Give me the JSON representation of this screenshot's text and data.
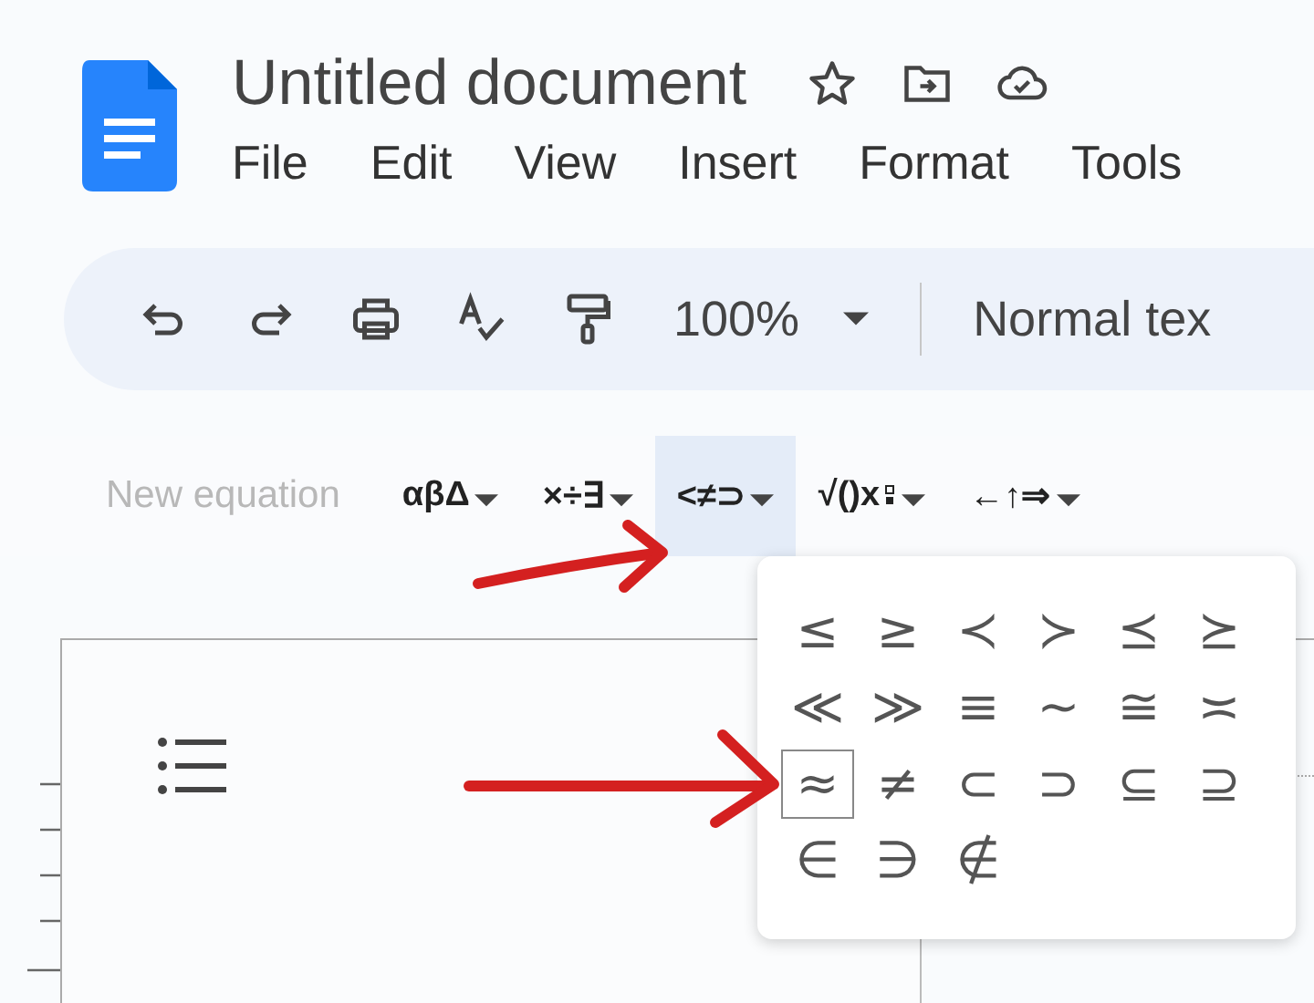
{
  "document": {
    "title": "Untitled document"
  },
  "menu": [
    {
      "label": "File"
    },
    {
      "label": "Edit"
    },
    {
      "label": "View"
    },
    {
      "label": "Insert"
    },
    {
      "label": "Format"
    },
    {
      "label": "Tools"
    }
  ],
  "toolbar": {
    "zoom": "100%",
    "style": "Normal tex"
  },
  "equation_bar": {
    "new_equation": "New equation",
    "groups": [
      {
        "label": "αβΔ",
        "kind": "text",
        "selected": false
      },
      {
        "label": "×÷∃",
        "kind": "text",
        "selected": false
      },
      {
        "label": "<≠⊃",
        "kind": "text",
        "selected": true
      },
      {
        "label": "√()x",
        "kind": "script",
        "selected": false
      },
      {
        "label": "←↑⇒",
        "kind": "text",
        "selected": false
      }
    ]
  },
  "symbol_menu": {
    "rows": [
      [
        {
          "symbol": "≤",
          "selected": false
        },
        {
          "symbol": "≥",
          "selected": false
        },
        {
          "symbol": "≺",
          "selected": false
        },
        {
          "symbol": "≻",
          "selected": false
        },
        {
          "symbol": "⪯",
          "selected": false
        },
        {
          "symbol": "⪰",
          "selected": false
        }
      ],
      [
        {
          "symbol": "≪",
          "selected": false
        },
        {
          "symbol": "≫",
          "selected": false
        },
        {
          "symbol": "≡",
          "selected": false
        },
        {
          "symbol": "∼",
          "selected": false
        },
        {
          "symbol": "≅",
          "selected": false
        },
        {
          "symbol": "≍",
          "selected": false
        }
      ],
      [
        {
          "symbol": "≈",
          "selected": true
        },
        {
          "symbol": "≠",
          "selected": false
        },
        {
          "symbol": "⊂",
          "selected": false
        },
        {
          "symbol": "⊃",
          "selected": false
        },
        {
          "symbol": "⊆",
          "selected": false
        },
        {
          "symbol": "⊇",
          "selected": false
        }
      ],
      [
        {
          "symbol": "∈",
          "selected": false
        },
        {
          "symbol": "∋",
          "selected": false
        },
        {
          "symbol": "∉",
          "selected": false
        }
      ]
    ]
  }
}
